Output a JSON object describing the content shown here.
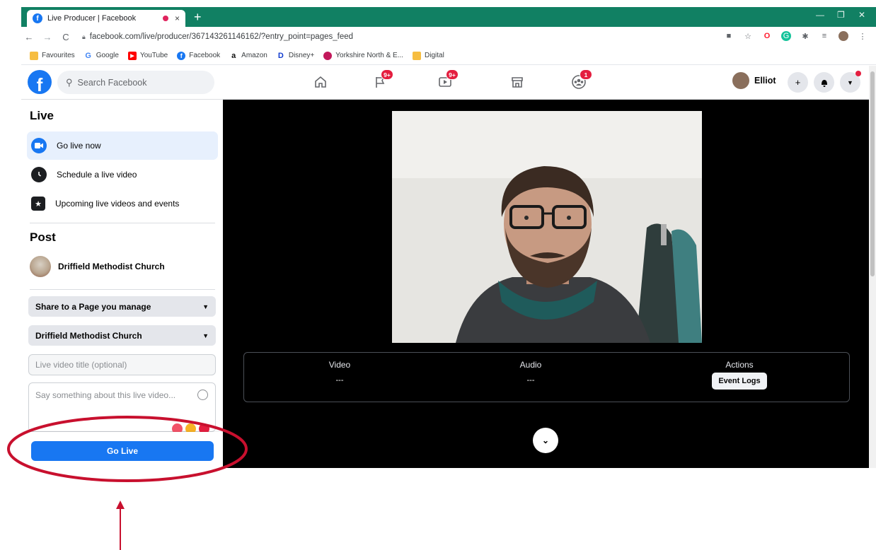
{
  "browser": {
    "tab_title": "Live Producer | Facebook",
    "tab_close": "×",
    "new_tab": "+",
    "url": "facebook.com/live/producer/367143261146162/?entry_point=pages_feed",
    "bookmarks": [
      {
        "label": "Favourites",
        "icon": "folder-icon",
        "color": "#f6bd41"
      },
      {
        "label": "Google",
        "icon": "google-icon",
        "color": "#4285f4"
      },
      {
        "label": "YouTube",
        "icon": "youtube-icon",
        "color": "#ff0000"
      },
      {
        "label": "Facebook",
        "icon": "facebook-icon",
        "color": "#1877f2"
      },
      {
        "label": "Amazon",
        "icon": "amazon-icon",
        "color": "#111111"
      },
      {
        "label": "Disney+",
        "icon": "disney-icon",
        "color": "#113ccf"
      },
      {
        "label": "Yorkshire North & E...",
        "icon": "globe-icon",
        "color": "#c2185b"
      },
      {
        "label": "Digital",
        "icon": "folder-icon",
        "color": "#f6bd41"
      }
    ]
  },
  "fb": {
    "search_placeholder": "Search Facebook",
    "badges": {
      "pages": "9+",
      "watch": "9+",
      "groups": "1"
    },
    "user_name": "Elliot",
    "brand_color": "#1877f2"
  },
  "sidebar": {
    "live_title": "Live",
    "items": [
      {
        "label": "Go live now",
        "icon": "camera-icon",
        "active": true
      },
      {
        "label": "Schedule a live video",
        "icon": "clock-icon",
        "active": false
      },
      {
        "label": "Upcoming live videos and events",
        "icon": "calendar-star-icon",
        "active": false
      }
    ],
    "post_title": "Post",
    "page_name": "Driffield Methodist Church",
    "share_select": "Share to a Page you manage",
    "page_select": "Driffield Methodist Church",
    "title_placeholder": "Live video title (optional)",
    "description_placeholder": "Say something about this live video...",
    "go_live": "Go Live"
  },
  "main": {
    "metrics": [
      {
        "label": "Video",
        "value": "---"
      },
      {
        "label": "Audio",
        "value": "---"
      },
      {
        "label": "Actions",
        "button": "Event Logs"
      }
    ]
  }
}
